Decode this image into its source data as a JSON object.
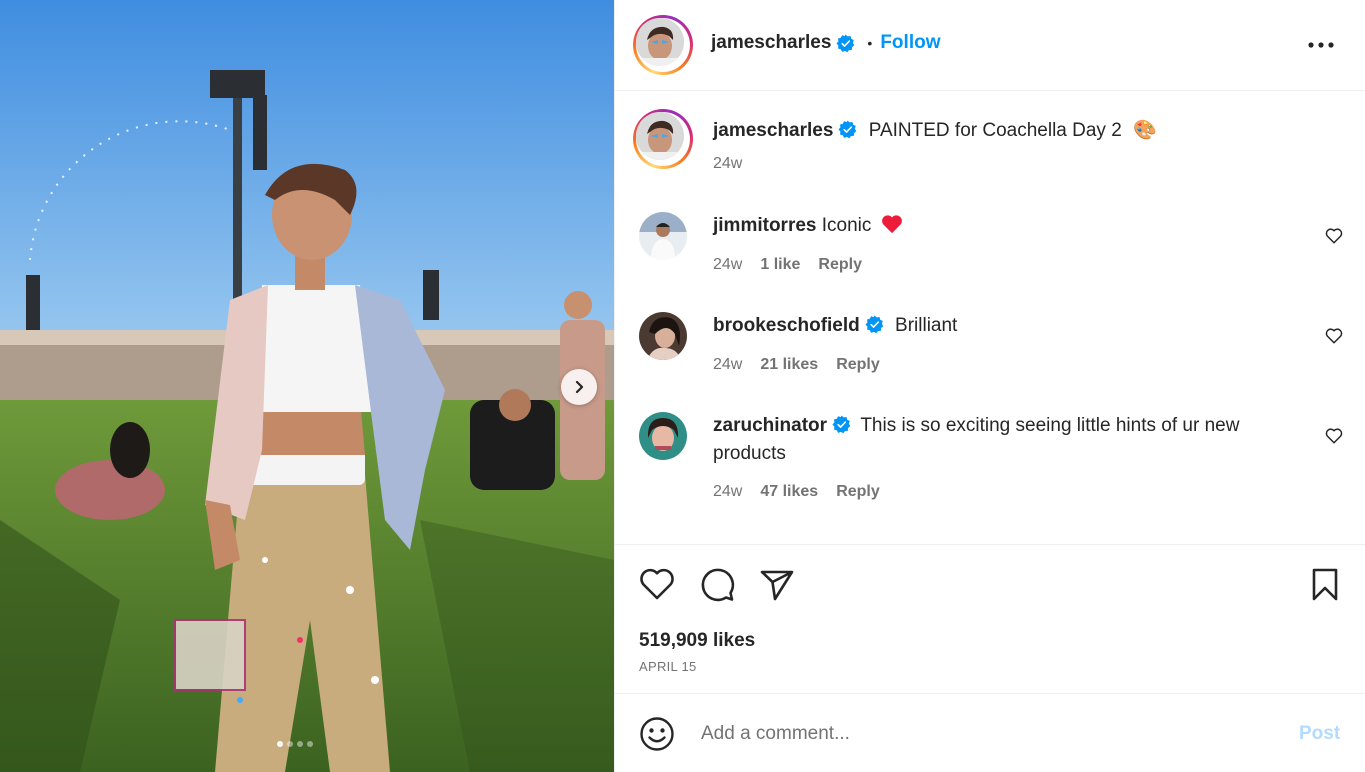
{
  "post": {
    "author": {
      "username": "jamescharles",
      "verified_icon": "verified-badge-icon",
      "follow_label": "Follow",
      "separator": "•"
    },
    "caption": {
      "username": "jamescharles",
      "text": "PAINTED for Coachella Day 2",
      "emoji": "🎨",
      "time": "24w"
    },
    "comments": [
      {
        "username": "jimmitorres",
        "verified": false,
        "text": "Iconic",
        "emoji": "❤️",
        "time": "24w",
        "likes": "1 like",
        "reply": "Reply"
      },
      {
        "username": "brookeschofield",
        "verified": true,
        "text": "Brilliant",
        "time": "24w",
        "likes": "21 likes",
        "reply": "Reply"
      },
      {
        "username": "zaruchinator",
        "verified": true,
        "text": "This is so exciting seeing little hints of ur new products",
        "time": "24w",
        "likes": "47 likes",
        "reply": "Reply"
      }
    ],
    "likes_count": "519,909 likes",
    "date": "APRIL 15",
    "composer": {
      "placeholder": "Add a comment...",
      "post_label": "Post"
    },
    "carousel": {
      "total": 4,
      "active_index": 0
    }
  },
  "colors": {
    "accent": "#0095f6",
    "verified": "#0095f6",
    "secondary_text": "#737373",
    "post_disabled": "#b3dbff",
    "heart_red": "#ed1c3a"
  }
}
